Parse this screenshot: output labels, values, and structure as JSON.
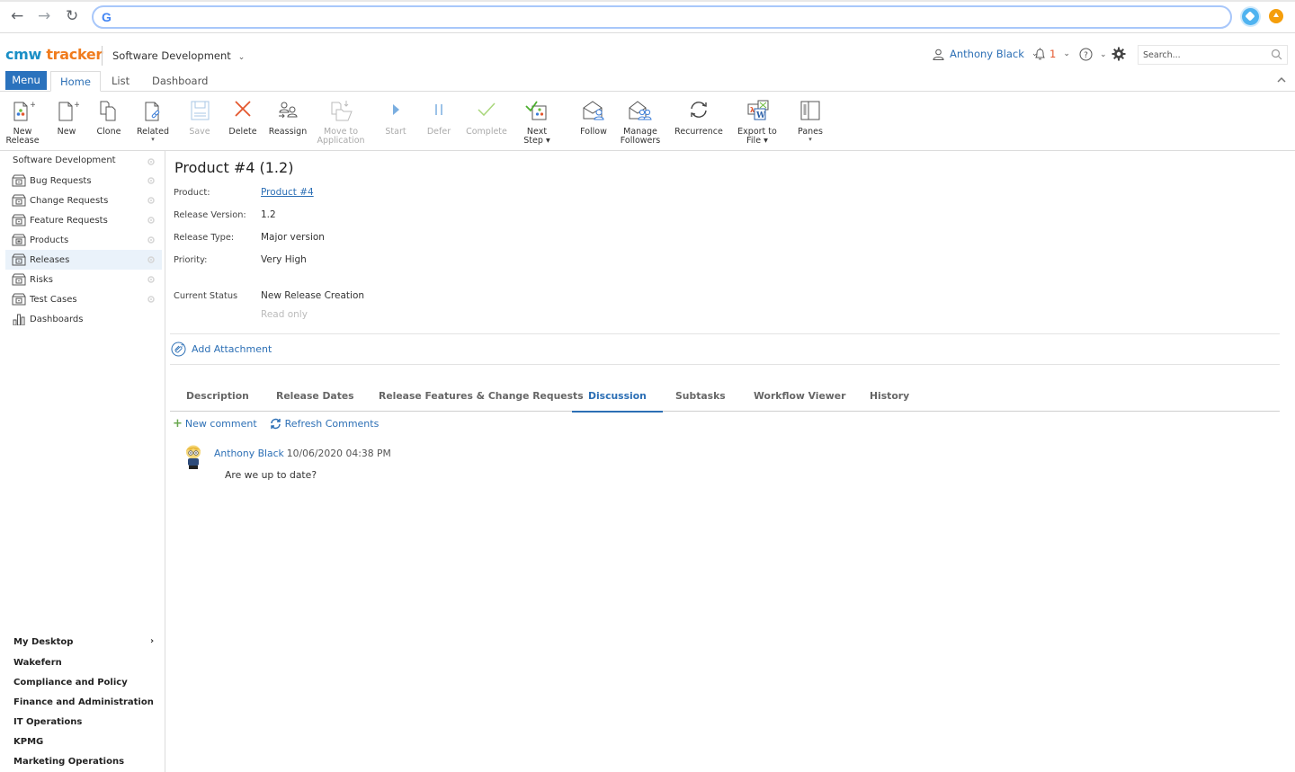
{
  "browser": {
    "address_value": "",
    "google_glyph": "G"
  },
  "header": {
    "logo_part1": "cmw",
    "logo_part2": "tracker",
    "workspace": "Software Development",
    "user_name": "Anthony Black",
    "notification_count": "1",
    "search_placeholder": "Search...",
    "colors": {
      "brand_blue": "#1b8fc6",
      "brand_orange": "#f07c1e",
      "accent": "#2c6fb5"
    }
  },
  "top_tabs": {
    "menu_label": "Menu",
    "tabs": [
      {
        "label": "Home",
        "active": true
      },
      {
        "label": "List",
        "active": false
      },
      {
        "label": "Dashboard",
        "active": false
      }
    ]
  },
  "ribbon": {
    "buttons": [
      {
        "line1": "New",
        "line2": "Release",
        "icon": "new-release-icon",
        "enabled": true
      },
      {
        "line1": "New",
        "line2": "",
        "icon": "new-document-icon",
        "enabled": true
      },
      {
        "line1": "Clone",
        "line2": "",
        "icon": "clone-icon",
        "enabled": true
      },
      {
        "line1": "Related",
        "line2": "",
        "icon": "related-link-icon",
        "enabled": true,
        "dropdown": true
      },
      {
        "line1": "Save",
        "line2": "",
        "icon": "save-icon",
        "enabled": false
      },
      {
        "line1": "Delete",
        "line2": "",
        "icon": "delete-icon",
        "enabled": true
      },
      {
        "line1": "Reassign",
        "line2": "",
        "icon": "reassign-icon",
        "enabled": true
      },
      {
        "line1": "Move to",
        "line2": "Application",
        "icon": "move-folder-icon",
        "enabled": false
      },
      {
        "line1": "Start",
        "line2": "",
        "icon": "play-icon",
        "enabled": false
      },
      {
        "line1": "Defer",
        "line2": "",
        "icon": "pause-icon",
        "enabled": false
      },
      {
        "line1": "Complete",
        "line2": "",
        "icon": "checkmark-icon",
        "enabled": false
      },
      {
        "line1": "Next",
        "line2": "Step",
        "icon": "next-step-icon",
        "enabled": true,
        "dropdown": true
      },
      {
        "line1": "Follow",
        "line2": "",
        "icon": "follow-icon",
        "enabled": true
      },
      {
        "line1": "Manage",
        "line2": "Followers",
        "icon": "manage-followers-icon",
        "enabled": true
      },
      {
        "line1": "Recurrence",
        "line2": "",
        "icon": "recurrence-icon",
        "enabled": true
      },
      {
        "line1": "Export to",
        "line2": "File",
        "icon": "export-file-icon",
        "enabled": true,
        "dropdown": true
      },
      {
        "line1": "Panes",
        "line2": "",
        "icon": "panes-icon",
        "enabled": true,
        "dropdown": true
      }
    ],
    "dropdown_glyph": "▾"
  },
  "sidebar": {
    "heading": "Software Development",
    "items": [
      {
        "label": "Bug Requests",
        "active": false
      },
      {
        "label": "Change Requests",
        "active": false
      },
      {
        "label": "Feature Requests",
        "active": false
      },
      {
        "label": "Products",
        "active": false
      },
      {
        "label": "Releases",
        "active": true
      },
      {
        "label": "Risks",
        "active": false
      },
      {
        "label": "Test Cases",
        "active": false
      },
      {
        "label": "Dashboards",
        "active": false
      }
    ],
    "bottom_items": [
      {
        "label": "My Desktop",
        "has_children": true
      },
      {
        "label": "Wakefern"
      },
      {
        "label": "Compliance and Policy"
      },
      {
        "label": "Finance and Administration"
      },
      {
        "label": "IT Operations"
      },
      {
        "label": "KPMG"
      },
      {
        "label": "Marketing Operations"
      }
    ],
    "chevron_glyph": "›"
  },
  "record": {
    "title": "Product #4 (1.2)",
    "fields": [
      {
        "label": "Product:",
        "value": "Product #4",
        "is_link": true
      },
      {
        "label": "Release Version:",
        "value": "1.2"
      },
      {
        "label": "Release Type:",
        "value": "Major version"
      },
      {
        "label": "Priority:",
        "value": "Very High"
      }
    ],
    "status": {
      "label": "Current Status",
      "value": "New Release Creation",
      "hint": "Read only"
    },
    "add_attachment": "Add Attachment"
  },
  "detail_tabs": {
    "tabs": [
      {
        "label": "Description",
        "active": false
      },
      {
        "label": "Release Dates",
        "active": false
      },
      {
        "label": "Release Features & Change Requests",
        "active": false
      },
      {
        "label": "Discussion",
        "active": true
      },
      {
        "label": "Subtasks",
        "active": false
      },
      {
        "label": "Workflow Viewer",
        "active": false
      },
      {
        "label": "History",
        "active": false
      }
    ]
  },
  "discussion": {
    "new_comment": "New comment",
    "refresh_comments": "Refresh Comments",
    "comments": [
      {
        "author": "Anthony Black",
        "timestamp": "10/06/2020 04:38 PM",
        "text": "Are we up to date?"
      }
    ]
  }
}
